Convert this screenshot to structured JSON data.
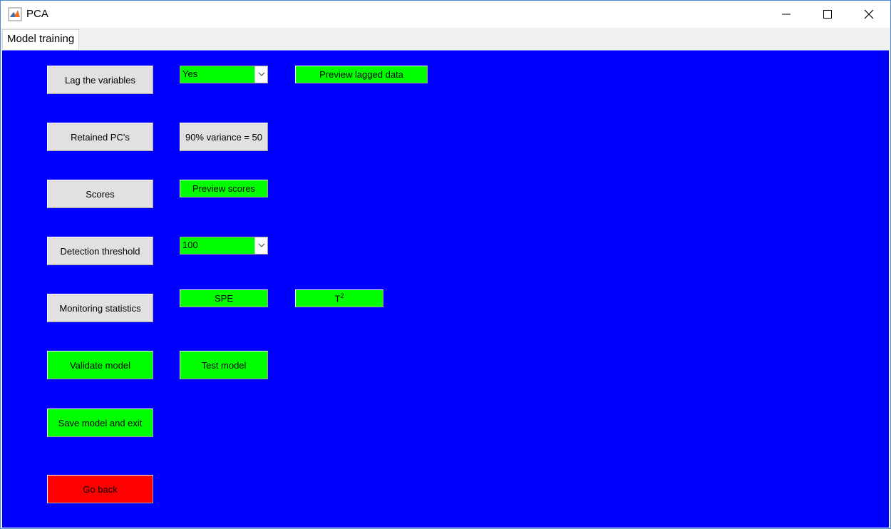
{
  "window": {
    "title": "PCA",
    "icon": "matlab-icon",
    "controls": [
      "minimize-icon",
      "maximize-icon",
      "close-icon"
    ]
  },
  "tabs": [
    {
      "label": "Model training",
      "selected": true
    }
  ],
  "colors": {
    "panel_background": "#0000ff",
    "gray_button": "#e1e1e1",
    "green_button": "#00ff00",
    "red_button": "#ff0000"
  },
  "left_buttons": {
    "lag": "Lag the variables",
    "retained": "Retained PC's",
    "scores": "Scores",
    "threshold": "Detection threshold",
    "monitoring": "Monitoring statistics",
    "validate": "Validate model",
    "save": "Save model and exit",
    "goback": "Go back"
  },
  "controls": {
    "lag_select": {
      "value": "Yes"
    },
    "preview_lagged": "Preview lagged data",
    "variance_label": "90% variance =  50",
    "preview_scores": "Preview scores",
    "threshold_select": {
      "value": "100"
    },
    "spe": "SPE",
    "t2_base": "T",
    "t2_sup": "2",
    "test_model": "Test model"
  }
}
